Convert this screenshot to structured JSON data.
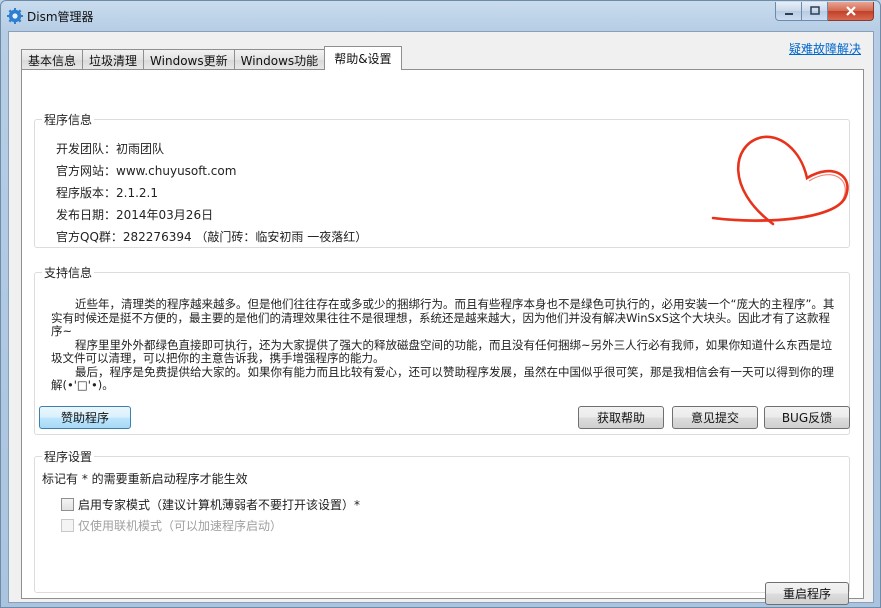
{
  "window": {
    "title": "Dism管理器"
  },
  "tabs": [
    {
      "label": "基本信息"
    },
    {
      "label": "垃圾清理"
    },
    {
      "label": "Windows更新"
    },
    {
      "label": "Windows功能"
    },
    {
      "label": "帮助&设置"
    }
  ],
  "help_link": "疑难故障解决",
  "program_info": {
    "title": "程序信息",
    "team": "开发团队：初雨团队",
    "website": "官方网站：www.chuyusoft.com",
    "version": "程序版本：2.1.2.1",
    "release_date": "发布日期：2014年03月26日",
    "qq_group": "官方QQ群：282276394 （敲门砖：临安初雨 一夜落红）"
  },
  "support": {
    "title": "支持信息",
    "paragraphs": [
      "近些年，清理类的程序越来越多。但是他们往往存在或多或少的捆绑行为。而且有些程序本身也不是绿色可执行的，必用安装一个“庞大的主程序”。其实有时候还是挺不方便的，最主要的是他们的清理效果往往不是很理想，系统还是越来越大，因为他们并没有解决WinSxS这个大块头。因此才有了这款程序~",
      "程序里里外外都绿色直接即可执行，还为大家提供了强大的释放磁盘空间的功能，而且没有任何捆绑~另外三人行必有我师，如果你知道什么东西是垃圾文件可以清理，可以把你的主意告诉我，携手增强程序的能力。",
      "最后，程序是免费提供给大家的。如果你有能力而且比较有爱心，还可以赞助程序发展，虽然在中国似乎很可笑，那是我相信会有一天可以得到你的理解(•'□'•)。"
    ],
    "buttons": {
      "sponsor": "赞助程序",
      "get_help": "获取帮助",
      "feedback": "意见提交",
      "bug": "BUG反馈"
    }
  },
  "settings": {
    "title": "程序设置",
    "note": "标记有 * 的需要重新启动程序才能生效",
    "expert_mode": {
      "label": "启用专家模式（建议计算机薄弱者不要打开该设置）*",
      "checked": false,
      "enabled": true
    },
    "online_mode": {
      "label": "仅使用联机模式（可以加速程序启动）",
      "checked": false,
      "enabled": false
    },
    "restart": "重启程序"
  },
  "colors": {
    "heart": "#e8331c",
    "link": "#0066cc",
    "accent": "#3c7fb1"
  }
}
